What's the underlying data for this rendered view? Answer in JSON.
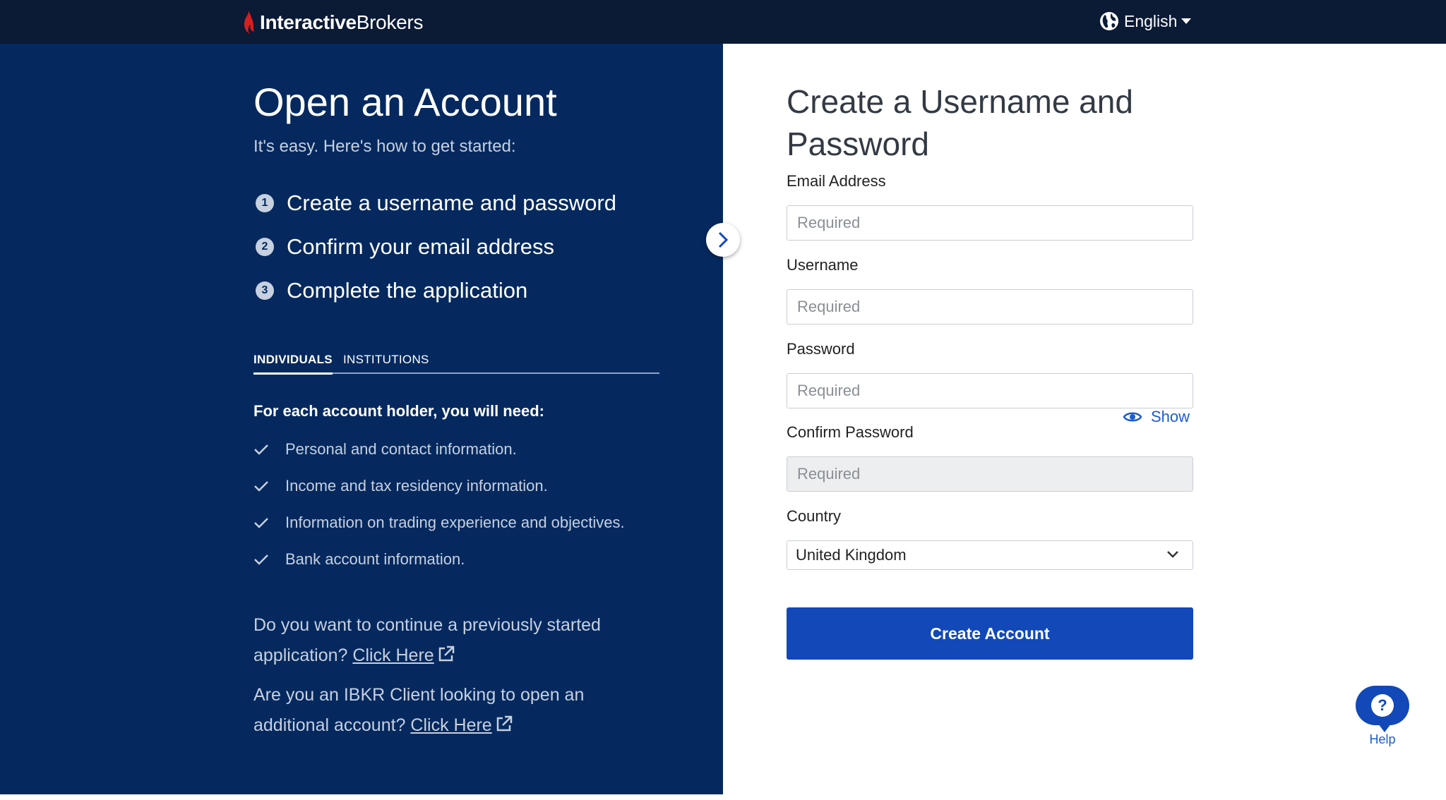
{
  "header": {
    "brand_bold": "Interactive",
    "brand_regular": "Brokers",
    "language": "English",
    "colors": {
      "bar": "#0b1a35",
      "logo_accent": "#d81e1e"
    }
  },
  "intro": {
    "title": "Open an Account",
    "subtitle": "It's easy. Here's how to get started:",
    "steps": [
      {
        "num": "1",
        "label": "Create a username and password"
      },
      {
        "num": "2",
        "label": "Confirm your email address"
      },
      {
        "num": "3",
        "label": "Complete the application"
      }
    ],
    "tabs": [
      {
        "label": "INDIVIDUALS",
        "active": true
      },
      {
        "label": "INSTITUTIONS",
        "active": false
      }
    ],
    "needs_title": "For each account holder, you will need:",
    "needs": [
      "Personal and contact information.",
      "Income and tax residency information.",
      "Information on trading experience and objectives.",
      "Bank account information."
    ],
    "continue_text": "Do you want to continue a previously started application?",
    "continue_link": "Click Here",
    "client_text": "Are you an IBKR Client looking to open an additional account?",
    "client_link": "Click Here",
    "colors": {
      "panel": "#05295e",
      "muted_text": "#c6d0e0"
    }
  },
  "form": {
    "title": "Create a Username and Password",
    "email_label": "Email Address",
    "email_placeholder": "Required",
    "username_label": "Username",
    "username_placeholder": "Required",
    "password_label": "Password",
    "password_placeholder": "Required",
    "show_label": "Show",
    "confirm_label": "Confirm Password",
    "confirm_placeholder": "Required",
    "country_label": "Country",
    "country_value": "United Kingdom",
    "submit_label": "Create Account",
    "colors": {
      "primary": "#1248b8",
      "link": "#1b5ccf"
    }
  },
  "help": {
    "icon_glyph": "?",
    "label": "Help"
  }
}
